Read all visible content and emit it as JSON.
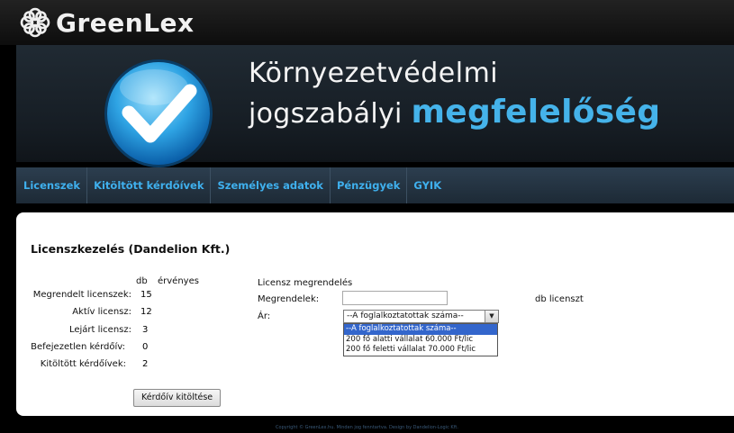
{
  "logo": {
    "text": "GreenLex"
  },
  "banner": {
    "line1": "Környezetvédelmi",
    "line2_prefix": "jogszabályi ",
    "line2_emph": "megfelelőség"
  },
  "nav": [
    "Licenszek",
    "Kitöltött kérdőívek",
    "Személyes adatok",
    "Pénzügyek",
    "GYIK"
  ],
  "main": {
    "title": "Licenszkezelés (Dandelion Kft.)",
    "stats": {
      "col_db": "db",
      "col_valid": "érvényes",
      "rows": [
        {
          "label": "Megrendelt licenszek:",
          "value": "15"
        },
        {
          "label": "Aktív licensz:",
          "value": "12"
        },
        {
          "label": "Lejárt licensz:",
          "value": "3"
        },
        {
          "label": "Befejezetlen kérdőív:",
          "value": "0"
        },
        {
          "label": "Kitöltött kérdőívek:",
          "value": "2"
        }
      ],
      "button": "Kérdőív kitöltése"
    },
    "order": {
      "title": "Licensz megrendelés",
      "qty_label": "Megrendelek:",
      "qty_value": "",
      "unit": "db licenszt",
      "price_label": "Ár:",
      "price_selected": "--A foglalkoztatottak száma--",
      "price_options": [
        "--A foglalkoztatottak száma--",
        "200 fő alatti vállalat 60.000 Ft/lic",
        "200 fő feletti vállalat 70.000 Ft/lic"
      ]
    }
  },
  "footer": "Copyright © GreenLex.hu. Minden jog fenntartva. Design by Dandelion-Logic Kft.",
  "colors": {
    "accent": "#3fb0ee",
    "highlight": "#3366cc",
    "emphasis": "#45b3ea"
  }
}
